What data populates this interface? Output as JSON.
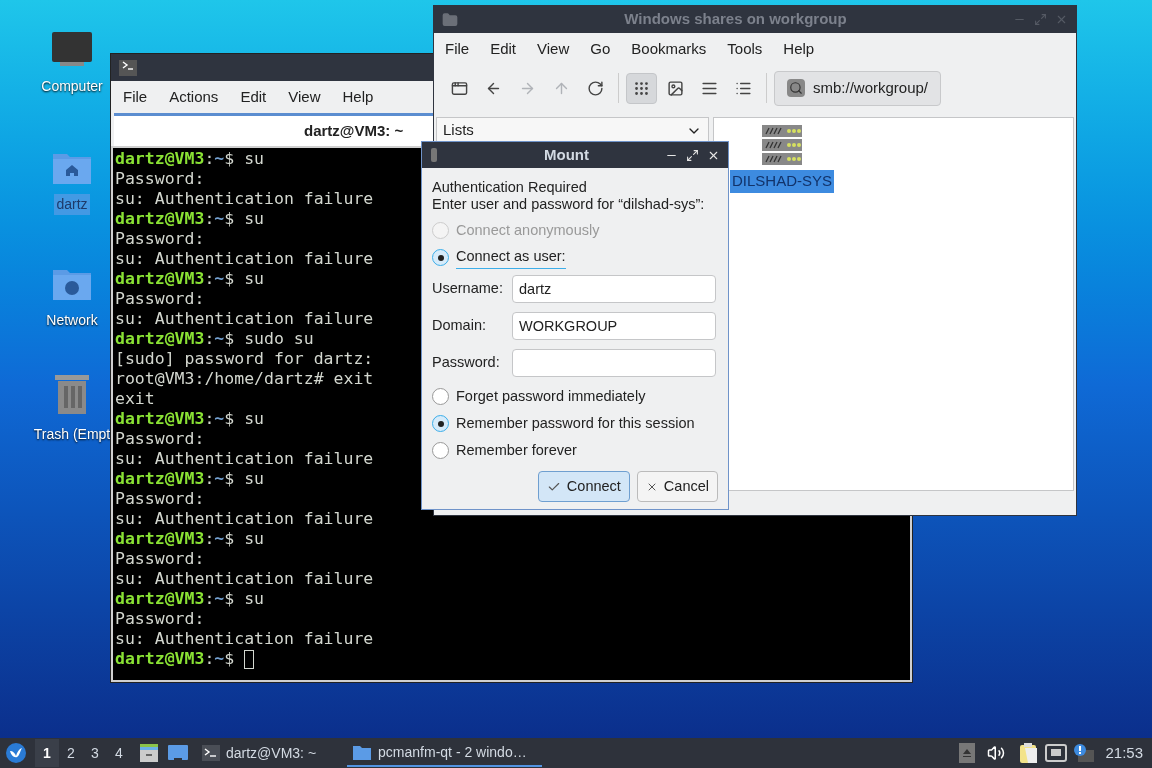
{
  "desktop_icons": [
    {
      "kind": "computer",
      "label": "Computer",
      "selected": false
    },
    {
      "kind": "home",
      "label": "dartz",
      "selected": true
    },
    {
      "kind": "network",
      "label": "Network",
      "selected": false
    },
    {
      "kind": "trash",
      "label": "Trash (Empt",
      "selected": false
    }
  ],
  "terminal": {
    "menu": [
      "File",
      "Actions",
      "Edit",
      "View",
      "Help"
    ],
    "tabs": [
      {
        "label": "dartz@VM3: ~",
        "selected": true
      }
    ],
    "lines": [
      {
        "kind": "prompt",
        "host": "dartz@VM3",
        "sep": ":",
        "path": "~",
        "symbol": "$ su"
      },
      {
        "kind": "output",
        "text": "Password:"
      },
      {
        "kind": "output",
        "text": "su: Authentication failure"
      },
      {
        "kind": "prompt",
        "host": "dartz@VM3",
        "sep": ":",
        "path": "~",
        "symbol": "$ su"
      },
      {
        "kind": "output",
        "text": "Password:"
      },
      {
        "kind": "output",
        "text": "su: Authentication failure"
      },
      {
        "kind": "prompt",
        "host": "dartz@VM3",
        "sep": ":",
        "path": "~",
        "symbol": "$ su"
      },
      {
        "kind": "output",
        "text": "Password:"
      },
      {
        "kind": "output",
        "text": "su: Authentication failure"
      },
      {
        "kind": "prompt",
        "host": "dartz@VM3",
        "sep": ":",
        "path": "~",
        "symbol": "$ sudo su"
      },
      {
        "kind": "output",
        "text": "[sudo] password for dartz:"
      },
      {
        "kind": "output",
        "text": "root@VM3:/home/dartz# exit"
      },
      {
        "kind": "output",
        "text": "exit"
      },
      {
        "kind": "prompt",
        "host": "dartz@VM3",
        "sep": ":",
        "path": "~",
        "symbol": "$ su"
      },
      {
        "kind": "output",
        "text": "Password:"
      },
      {
        "kind": "output",
        "text": "su: Authentication failure"
      },
      {
        "kind": "prompt",
        "host": "dartz@VM3",
        "sep": ":",
        "path": "~",
        "symbol": "$ su"
      },
      {
        "kind": "output",
        "text": "Password:"
      },
      {
        "kind": "output",
        "text": "su: Authentication failure"
      },
      {
        "kind": "prompt",
        "host": "dartz@VM3",
        "sep": ":",
        "path": "~",
        "symbol": "$ su"
      },
      {
        "kind": "output",
        "text": "Password:"
      },
      {
        "kind": "output",
        "text": "su: Authentication failure"
      },
      {
        "kind": "prompt",
        "host": "dartz@VM3",
        "sep": ":",
        "path": "~",
        "symbol": "$ su"
      },
      {
        "kind": "output",
        "text": "Password:"
      },
      {
        "kind": "output",
        "text": "su: Authentication failure"
      },
      {
        "kind": "prompt",
        "host": "dartz@VM3",
        "sep": ":",
        "path": "~",
        "symbol": "$ ",
        "cursor": true
      }
    ]
  },
  "file_manager": {
    "title": "Windows shares on workgroup",
    "menu": [
      "File",
      "Edit",
      "View",
      "Go",
      "Bookmarks",
      "Tools",
      "Help"
    ],
    "nav_buttons": [
      {
        "kind": "new_window",
        "disabled": false
      },
      {
        "kind": "back",
        "disabled": false
      },
      {
        "kind": "forward",
        "disabled": true
      },
      {
        "kind": "up",
        "disabled": true
      },
      {
        "kind": "reload",
        "disabled": false
      }
    ],
    "view_buttons": [
      {
        "kind": "icons",
        "selected": true
      },
      {
        "kind": "thumbnails",
        "selected": false
      },
      {
        "kind": "compact",
        "selected": false
      },
      {
        "kind": "details",
        "selected": false
      }
    ],
    "location": "smb://workgroup/",
    "side_pane": "Lists",
    "items": [
      {
        "kind": "server",
        "label": "DILSHAD-SYS",
        "selected": true
      }
    ]
  },
  "dialog": {
    "title": "Mount",
    "heading": "Authentication Required",
    "prompt": "Enter user and password for “dilshad-sys”:",
    "connect_options": [
      {
        "label": "Connect anonymously",
        "selected": false,
        "disabled": true
      },
      {
        "label": "Connect as user:",
        "selected": true,
        "disabled": false
      }
    ],
    "fields": [
      {
        "label": "Username:",
        "value": "dartz"
      },
      {
        "label": "Domain:",
        "value": "WORKGROUP"
      },
      {
        "label": "Password:"
      }
    ],
    "remember_options": [
      {
        "label": "Forget password immediately",
        "selected": false
      },
      {
        "label": "Remember password for this session",
        "selected": true
      },
      {
        "label": "Remember forever",
        "selected": false
      }
    ],
    "buttons": [
      {
        "kind": "confirm",
        "label": "Connect"
      },
      {
        "kind": "cancel",
        "label": "Cancel"
      }
    ]
  },
  "taskbar": {
    "workspaces": [
      {
        "label": "1",
        "selected": true
      },
      {
        "label": "2",
        "selected": false
      },
      {
        "label": "3",
        "selected": false
      },
      {
        "label": "4",
        "selected": false
      }
    ],
    "tasks": [
      {
        "kind": "terminal",
        "label": "dartz@VM3: ~",
        "selected": false
      },
      {
        "kind": "folder",
        "label": "pcmanfm-qt - 2 windo…",
        "selected": true
      }
    ],
    "clock": "21:53"
  }
}
